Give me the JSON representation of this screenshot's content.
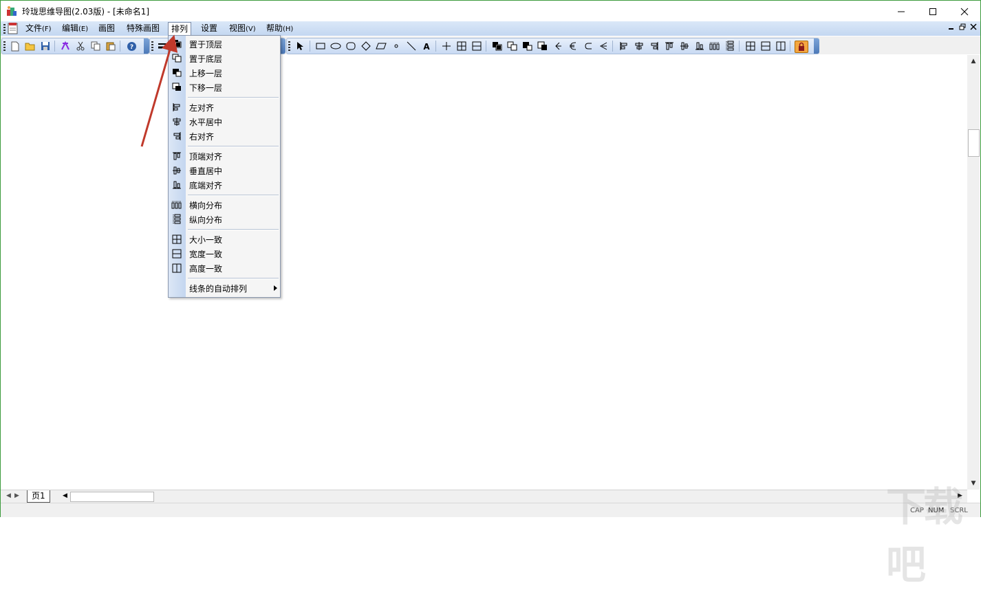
{
  "window": {
    "title": "玲珑思维导图(2.03版) - [未命名1]"
  },
  "menubar": {
    "items": [
      {
        "label": "文件",
        "accel": "(F)"
      },
      {
        "label": "编辑",
        "accel": "(E)"
      },
      {
        "label": "画图",
        "accel": ""
      },
      {
        "label": "特殊画图",
        "accel": ""
      },
      {
        "label": "排列",
        "accel": ""
      },
      {
        "label": "设置",
        "accel": ""
      },
      {
        "label": "视图",
        "accel": "(V)"
      },
      {
        "label": "帮助",
        "accel": "(H)"
      }
    ],
    "active": "排列"
  },
  "arrange_menu": {
    "items": [
      {
        "label": "置于顶层",
        "icon": "bring-to-front-icon"
      },
      {
        "label": "置于底层",
        "icon": "send-to-back-icon"
      },
      {
        "label": "上移一层",
        "icon": "bring-forward-icon"
      },
      {
        "label": "下移一层",
        "icon": "send-backward-icon"
      },
      {
        "label": "左对齐",
        "icon": "align-left-icon"
      },
      {
        "label": "水平居中",
        "icon": "align-center-horizontal-icon"
      },
      {
        "label": "右对齐",
        "icon": "align-right-icon"
      },
      {
        "label": "顶端对齐",
        "icon": "align-top-icon"
      },
      {
        "label": "垂直居中",
        "icon": "align-middle-vertical-icon"
      },
      {
        "label": "底端对齐",
        "icon": "align-bottom-icon"
      },
      {
        "label": "横向分布",
        "icon": "distribute-horizontal-icon"
      },
      {
        "label": "纵向分布",
        "icon": "distribute-vertical-icon"
      },
      {
        "label": "大小一致",
        "icon": "same-size-icon"
      },
      {
        "label": "宽度一致",
        "icon": "same-width-icon"
      },
      {
        "label": "高度一致",
        "icon": "same-height-icon"
      },
      {
        "label": "线条的自动排列",
        "icon": "submenu-arrow-icon"
      }
    ]
  },
  "tabs": {
    "page": "页1"
  },
  "statusbar": {
    "cap": "CAP",
    "num": "NUM",
    "scrl": "SCRL"
  },
  "watermark": "下载吧",
  "colors": {
    "accent": "#c3d7f1",
    "annotation_arrow": "#c0392b",
    "window_border": "#3c9b3c"
  }
}
